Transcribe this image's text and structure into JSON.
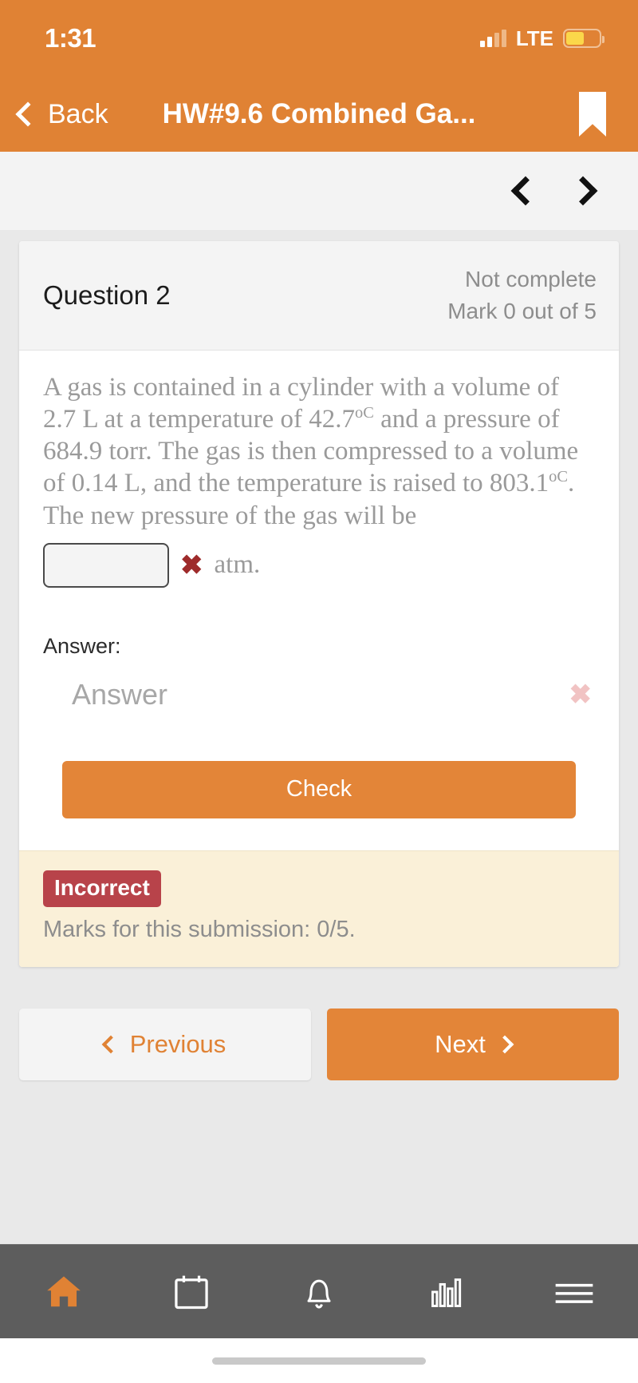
{
  "status_bar": {
    "time": "1:31",
    "network": "LTE",
    "signal_icon": "signal-bars-icon",
    "battery_icon": "battery-icon",
    "battery_level_pct": 55
  },
  "nav_bar": {
    "back_label": "Back",
    "title": "HW#9.6 Combined Ga...",
    "back_icon": "chevron-left-icon",
    "bookmark_icon": "bookmark-icon"
  },
  "quiz_nav": {
    "prev_icon": "chevron-left-icon",
    "next_icon": "chevron-right-icon"
  },
  "question": {
    "title": "Question 2",
    "state": "Not complete",
    "mark": "Mark 0 out of 5",
    "text_part_1": "A gas is contained in a cylinder with a volume of 2.7 L at a temperature of 42.7",
    "deg_c_1": "oC",
    "text_part_2": " and a pressure of 684.9 torr. The gas is then compressed to a volume of 0.14 L, and the temperature is raised to 803.1",
    "deg_c_2": "oC",
    "text_part_3": ". The new pressure of the gas will be",
    "inline_input_value": "",
    "inline_mark_icon": "cross-mark-icon",
    "inline_mark_glyph": "✖",
    "unit": "atm."
  },
  "answer_section": {
    "label": "Answer:",
    "input_value": "",
    "input_placeholder": "Answer",
    "clear_icon": "clear-x-icon",
    "clear_glyph": "✖"
  },
  "check_button": {
    "label": "Check"
  },
  "feedback": {
    "badge": "Incorrect",
    "marks": "Marks for this submission: 0/5."
  },
  "pager": {
    "previous_label": "Previous",
    "next_label": "Next",
    "prev_icon": "chevron-left-icon",
    "next_icon": "chevron-right-icon"
  },
  "tab_bar": {
    "items": [
      {
        "name": "home",
        "icon": "home-icon",
        "active": true
      },
      {
        "name": "calendar",
        "icon": "calendar-icon",
        "active": false
      },
      {
        "name": "notifications",
        "icon": "bell-icon",
        "active": false
      },
      {
        "name": "grades",
        "icon": "bar-chart-icon",
        "active": false
      },
      {
        "name": "menu",
        "icon": "hamburger-menu-icon",
        "active": false
      }
    ]
  },
  "colors": {
    "brand_orange": "#e08234",
    "button_orange": "#e38538",
    "incorrect_red": "#b8434a",
    "feedback_bg": "#faf0d8",
    "tab_bar_bg": "#5d5d5d",
    "page_bg": "#e9e9e9"
  }
}
